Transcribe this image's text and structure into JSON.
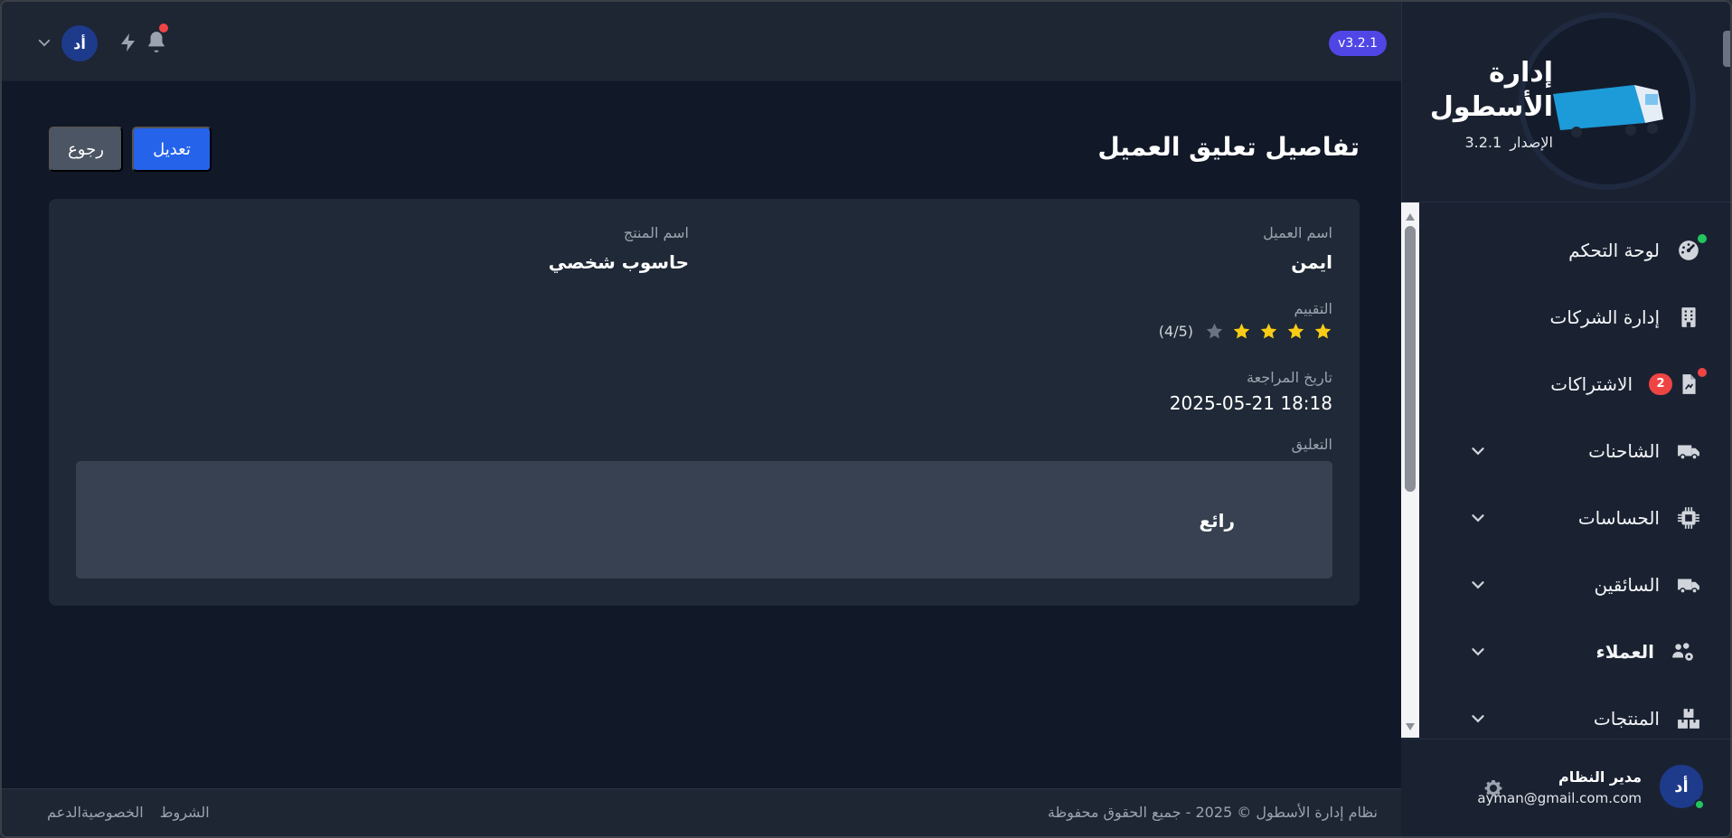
{
  "topbar": {
    "version_badge": "v3.2.1",
    "avatar_initials": "أد"
  },
  "brand": {
    "title_line1": "إدارة",
    "title_line2": "الأسطول",
    "version_label": "الإصدار",
    "version_number": "3.2.1"
  },
  "sidebar": {
    "items": [
      {
        "label": "لوحة التحكم",
        "icon": "dashboard-icon"
      },
      {
        "label": "إدارة الشركات",
        "icon": "building-icon"
      },
      {
        "label": "الاشتراكات",
        "icon": "file-invoice-icon",
        "badge": "2"
      },
      {
        "label": "الشاحنات",
        "icon": "truck-icon"
      },
      {
        "label": "الحساسات",
        "icon": "chip-icon"
      },
      {
        "label": "السائقين",
        "icon": "truck-icon"
      },
      {
        "label": "العملاء",
        "icon": "users-gear-icon"
      },
      {
        "label": "المنتجات",
        "icon": "boxes-icon"
      }
    ]
  },
  "user": {
    "initials": "أد",
    "name": "مدير النظام",
    "email": "ayman@gmail.com.com"
  },
  "page": {
    "title": "تفاصيل تعليق العميل",
    "edit_button": "تعديل",
    "back_button": "رجوع"
  },
  "feedback": {
    "customer_label": "اسم العميل",
    "customer_value": "ايمن",
    "product_label": "اسم المنتج",
    "product_value": "حاسوب شخصي",
    "rating_label": "التقييم",
    "rating": 4,
    "rating_max": 5,
    "rating_text": "(4/5)",
    "review_date_label": "تاريخ المراجعة",
    "review_date_value": "2025-05-21 18:18",
    "comment_label": "التعليق",
    "comment_value": "رائع"
  },
  "footer": {
    "copyright": "نظام إدارة الأسطول © 2025 - جميع الحقوق محفوظة",
    "links": [
      "الشروط",
      "الخصوصية",
      "الدعم"
    ]
  },
  "colors": {
    "primary": "#2563eb",
    "accent_badge": "#4f46e5",
    "star_filled": "#facc15",
    "star_empty": "#6b7280",
    "danger": "#ef4444",
    "success": "#22c55e"
  }
}
